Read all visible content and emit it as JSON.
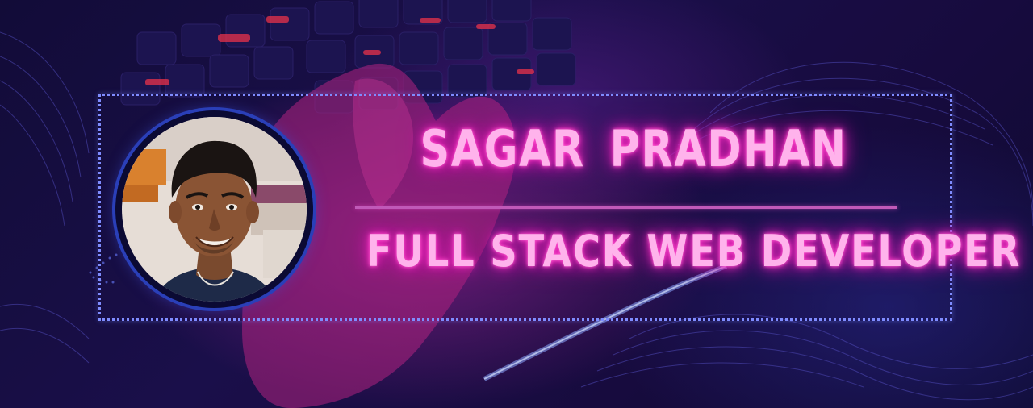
{
  "profile": {
    "name": "SAGAR  PRADHAN",
    "role": "FULL STACK WEB DEVELOPER"
  },
  "colors": {
    "neon_text": "#ffb3ec",
    "neon_glow": "#ff2fc4",
    "frame_dots": "#7f8cff",
    "background": "#120c38",
    "avatar_ring": "#2a3fb8"
  }
}
